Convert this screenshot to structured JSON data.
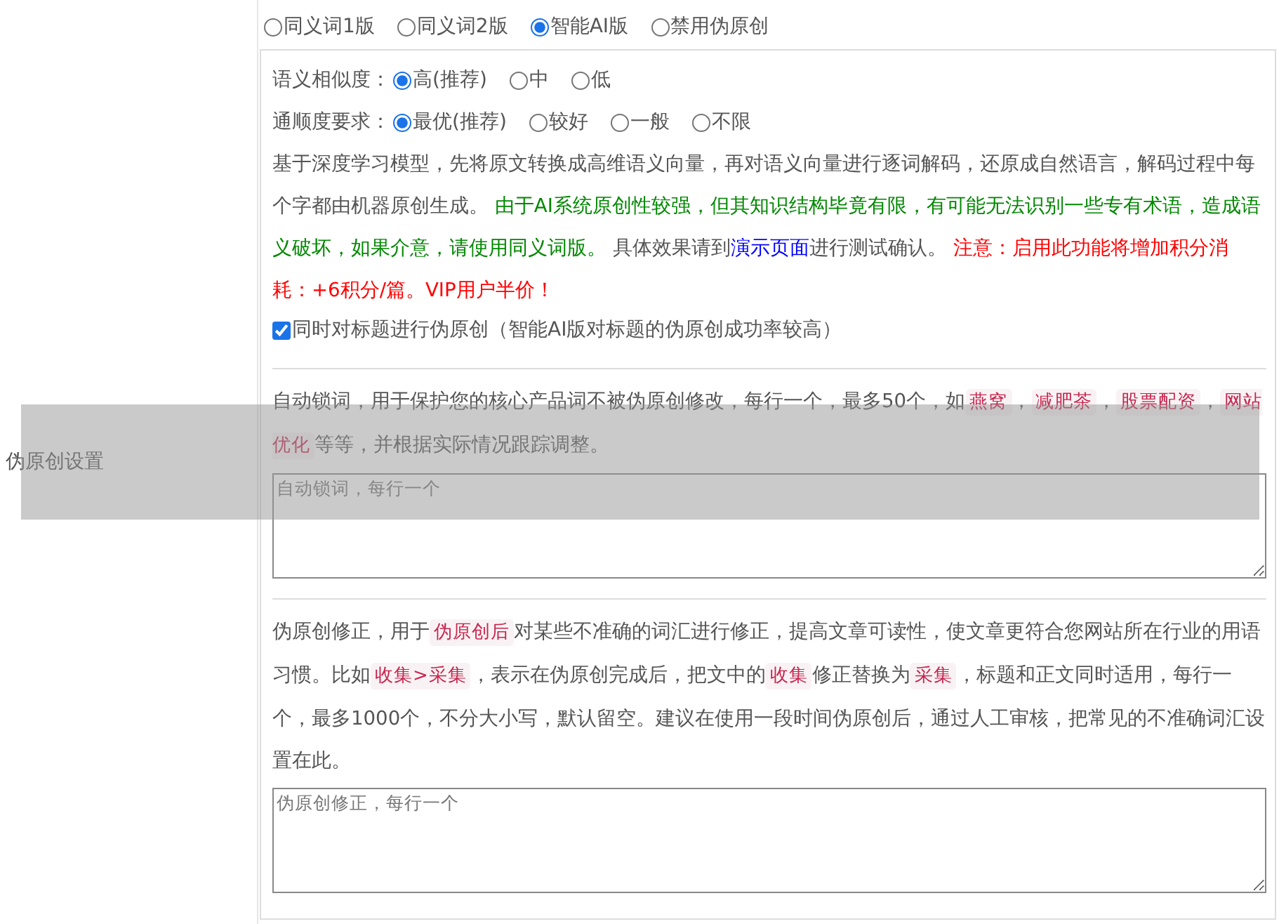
{
  "label": "伪原创设置",
  "modes": [
    {
      "label": "同义词1版",
      "selected": false
    },
    {
      "label": "同义词2版",
      "selected": false
    },
    {
      "label": "智能AI版",
      "selected": true
    },
    {
      "label": "禁用伪原创",
      "selected": false
    }
  ],
  "similarity": {
    "label": "语义相似度：",
    "options": [
      {
        "label": "高(推荐)",
        "selected": true
      },
      {
        "label": "中",
        "selected": false
      },
      {
        "label": "低",
        "selected": false
      }
    ]
  },
  "fluency": {
    "label": "通顺度要求：",
    "options": [
      {
        "label": "最优(推荐)",
        "selected": true
      },
      {
        "label": "较好",
        "selected": false
      },
      {
        "label": "一般",
        "selected": false
      },
      {
        "label": "不限",
        "selected": false
      }
    ]
  },
  "description": [
    {
      "kind": "plain",
      "text": "基于深度学习模型，先将原文转换成高维语义向量，再对语义向量进行逐词解码，还原成自然语言，解码过程中每个字都由机器原创生成。 "
    },
    {
      "kind": "note",
      "text": "由于AI系统原创性较强，但其知识结构毕竟有限，有可能无法识别一些专有术语，造成语义破坏，如果介意，请使用同义词版。"
    },
    {
      "kind": "plain",
      "text": " 具体效果请到"
    },
    {
      "kind": "link",
      "text": "演示页面"
    },
    {
      "kind": "plain",
      "text": "进行测试确认。 "
    },
    {
      "kind": "warning",
      "text": "注意：启用此功能将增加积分消耗：+6积分/篇。VIP用户半价！"
    }
  ],
  "title_checkbox": {
    "label": "同时对标题进行伪原创（智能AI版对标题的伪原创成功率较高）",
    "checked": true
  },
  "lock_words": {
    "segments": [
      {
        "kind": "plain",
        "text": "自动锁词，用于保护您的核心产品词不被伪原创修改，每行一个，最多50个，如"
      },
      {
        "kind": "tag",
        "text": "燕窝"
      },
      {
        "kind": "plain",
        "text": "，"
      },
      {
        "kind": "tag",
        "text": "减肥茶"
      },
      {
        "kind": "plain",
        "text": "，"
      },
      {
        "kind": "tag",
        "text": "股票配资"
      },
      {
        "kind": "plain",
        "text": "，"
      },
      {
        "kind": "tag",
        "text": "网站优化"
      },
      {
        "kind": "plain",
        "text": "等等，并根据实际情况跟踪调整。"
      }
    ],
    "placeholder": "自动锁词，每行一个"
  },
  "corrections": {
    "segments": [
      {
        "kind": "plain",
        "text": "伪原创修正，用于"
      },
      {
        "kind": "tag",
        "text": "伪原创后"
      },
      {
        "kind": "plain",
        "text": "对某些不准确的词汇进行修正，提高文章可读性，使文章更符合您网站所在行业的用语习惯。比如"
      },
      {
        "kind": "tag",
        "text": "收集>采集"
      },
      {
        "kind": "plain",
        "text": "，表示在伪原创完成后，把文中的"
      },
      {
        "kind": "tag",
        "text": "收集"
      },
      {
        "kind": "plain",
        "text": "修正替换为"
      },
      {
        "kind": "tag",
        "text": "采集"
      },
      {
        "kind": "plain",
        "text": "，标题和正文同时适用，每行一个，最多1000个，不分大小写，默认留空。建议在使用一段时间伪原创后，通过人工审核，把常见的不准确词汇设置在此。"
      }
    ],
    "placeholder": "伪原创修正，每行一个"
  }
}
